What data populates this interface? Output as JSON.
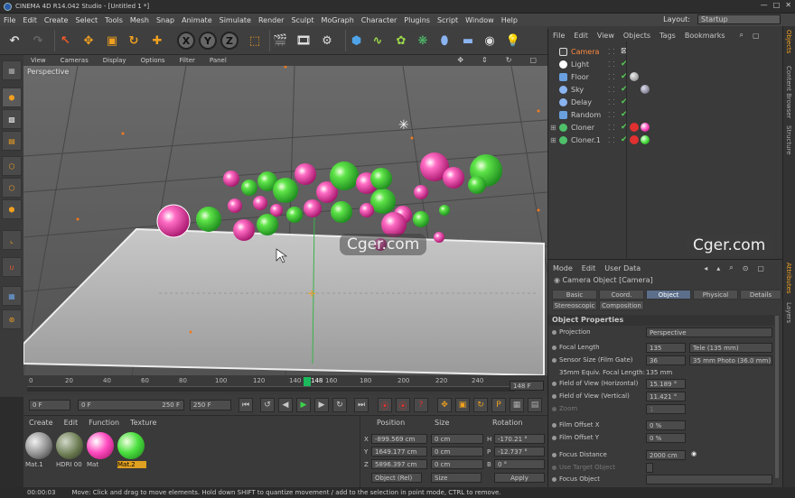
{
  "window": {
    "title": "CINEMA 4D R14.042 Studio - [Untitled 1 *]",
    "min": "—",
    "max": "□",
    "close": "✕"
  },
  "menu": [
    "File",
    "Edit",
    "Create",
    "Select",
    "Tools",
    "Mesh",
    "Snap",
    "Animate",
    "Simulate",
    "Render",
    "Sculpt",
    "MoGraph",
    "Character",
    "Plugins",
    "Script",
    "Window",
    "Help"
  ],
  "layout": {
    "label": "Layout:",
    "value": "Startup"
  },
  "viewport": {
    "menu": [
      "View",
      "Cameras",
      "Display",
      "Options",
      "Filter",
      "Panel"
    ],
    "label": "Perspective"
  },
  "timeline": {
    "ticks": [
      "0",
      "20",
      "40",
      "60",
      "80",
      "100",
      "120",
      "140",
      "148",
      "160",
      "180",
      "200",
      "220",
      "240"
    ],
    "current": "148",
    "frame_field": "148 F"
  },
  "transport": {
    "start": "0 F",
    "current": "0 F",
    "range_end": "250 F",
    "end": "250 F"
  },
  "materials": {
    "menu": [
      "Create",
      "Edit",
      "Function",
      "Texture"
    ],
    "items": [
      {
        "name": "Mat.1"
      },
      {
        "name": "HDRI 00"
      },
      {
        "name": "Mat"
      },
      {
        "name": "Mat.2"
      }
    ]
  },
  "coords": {
    "headers": [
      "Position",
      "Size",
      "Rotation"
    ],
    "rows": [
      {
        "axis": "X",
        "pos": "-899.569 cm",
        "size": "0 cm",
        "rot_axis": "H",
        "rot": "-170.21 °"
      },
      {
        "axis": "Y",
        "pos": "1649.177 cm",
        "size": "0 cm",
        "rot_axis": "P",
        "rot": "-12.737 °"
      },
      {
        "axis": "Z",
        "pos": "5896.397 cm",
        "size": "0 cm",
        "rot_axis": "B",
        "rot": "0 °"
      }
    ],
    "mode": "Object (Rel)",
    "size_mode": "Size",
    "apply": "Apply"
  },
  "objects": {
    "menu": [
      "File",
      "Edit",
      "View",
      "Objects",
      "Tags",
      "Bookmarks"
    ],
    "items": [
      {
        "name": "Camera",
        "color": "#ff8a3d"
      },
      {
        "name": "Light",
        "color": "#c8c8c8"
      },
      {
        "name": "Floor",
        "color": "#c8c8c8"
      },
      {
        "name": "Sky",
        "color": "#c8c8c8"
      },
      {
        "name": "Delay",
        "color": "#c8c8c8"
      },
      {
        "name": "Random",
        "color": "#c8c8c8"
      },
      {
        "name": "Cloner",
        "color": "#c8c8c8"
      },
      {
        "name": "Cloner.1",
        "color": "#c8c8c8"
      }
    ]
  },
  "attributes": {
    "menu": [
      "Mode",
      "Edit",
      "User Data"
    ],
    "title": "Camera Object [Camera]",
    "tabs": [
      "Basic",
      "Coord.",
      "Object",
      "Physical",
      "Details",
      "Stereoscopic",
      "Composition"
    ],
    "active_tab": "Object",
    "section": "Object Properties",
    "props": [
      {
        "label": "Projection",
        "value": "Perspective"
      },
      {
        "label": "Focal Length",
        "value": "135",
        "extra": "Tele (135 mm)"
      },
      {
        "label": "Sensor Size (Film Gate)",
        "value": "36",
        "extra": "35 mm Photo (36.0 mm)"
      },
      {
        "label": "35mm Equiv. Focal Length:",
        "value": "135 mm"
      },
      {
        "label": "Field of View (Horizontal)",
        "value": "15.189 °"
      },
      {
        "label": "Field of View (Vertical)",
        "value": "11.421 °"
      },
      {
        "label": "Zoom",
        "value": "1"
      },
      {
        "label": "Film Offset X",
        "value": "0 %"
      },
      {
        "label": "Film Offset Y",
        "value": "0 %"
      },
      {
        "label": "Focus Distance",
        "value": "2000 cm"
      },
      {
        "label": "Use Target Object",
        "value": ""
      },
      {
        "label": "Focus Object",
        "value": ""
      }
    ]
  },
  "sidetabs": [
    "Objects",
    "Content Browser",
    "Structure",
    "Attributes",
    "Layers"
  ],
  "status": {
    "time": "00:00:03",
    "message": "Move: Click and drag to move elements. Hold down SHIFT to quantize movement / add to the selection in point mode, CTRL to remove."
  },
  "watermark": "Cger.com",
  "colors": {
    "accent": "#1cba5c",
    "active_tab": "#5b6e8a",
    "camera": "#ff8a3d",
    "pink": "#e6359a",
    "green": "#36c940"
  }
}
